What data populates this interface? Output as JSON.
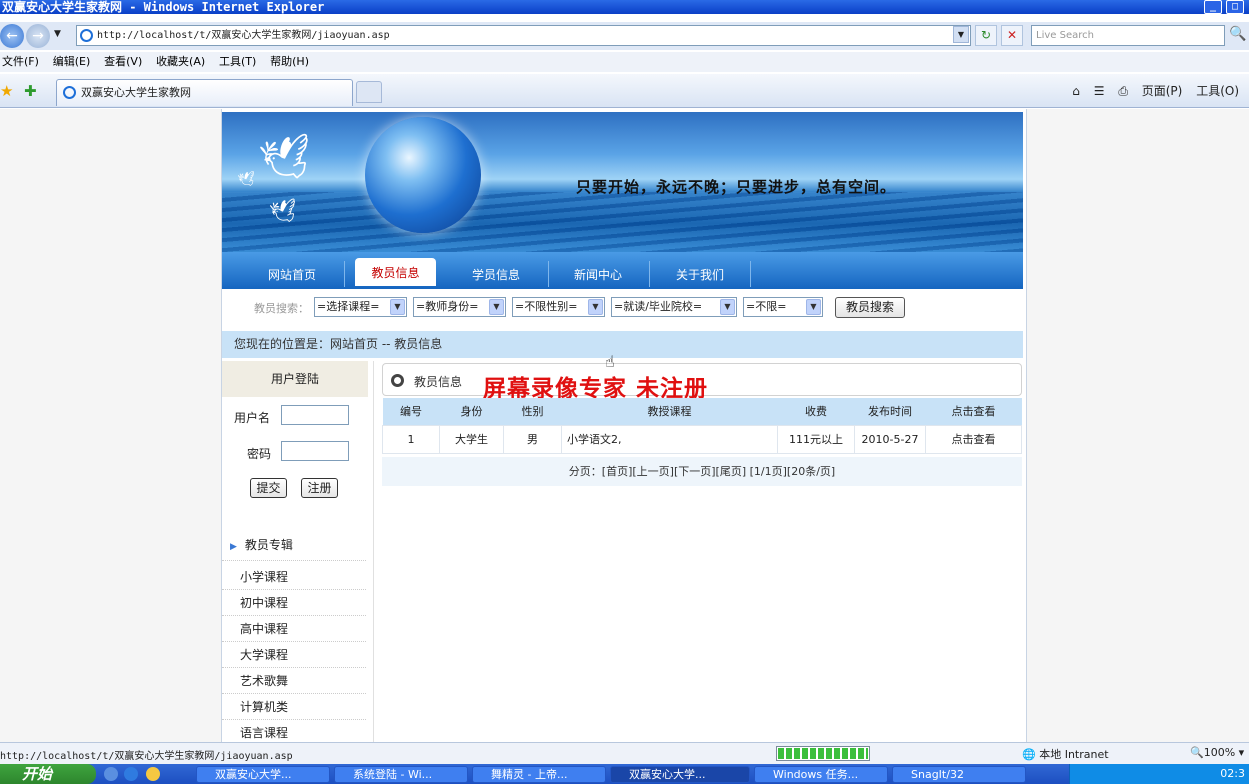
{
  "window": {
    "title": "双赢安心大学生家教网 - Windows Internet Explorer",
    "min": "_",
    "max": "□"
  },
  "toolbar": {
    "back": "←",
    "forward": "→",
    "address": "http://localhost/t/双赢安心大学生家教网/jiaoyuan.asp",
    "refresh": "↻",
    "stop": "✕",
    "search_placeholder": "Live Search",
    "search_go": "🔍"
  },
  "menu": {
    "items": [
      "文件(F)",
      "编辑(E)",
      "查看(V)",
      "收藏夹(A)",
      "工具(T)",
      "帮助(H)"
    ]
  },
  "tabs": {
    "active_label": "双赢安心大学生家教网"
  },
  "commands": {
    "home": "⌂",
    "feeds": "☰",
    "print": "⎙",
    "page": "页面(P)",
    "tools": "工具(O)"
  },
  "site": {
    "slogan": "只要开始，永远不晚；只要进步，总有空间。",
    "nav": [
      "网站首页",
      "教员信息",
      "学员信息",
      "新闻中心",
      "关于我们"
    ],
    "active_nav": "教员信息",
    "search": {
      "label": "教员搜索：",
      "selects": [
        "=选择课程=",
        "=教师身份=",
        "=不限性别=",
        "=就读/毕业院校=",
        "=不限="
      ],
      "button": "教员搜索"
    },
    "breadcrumb": "您现在的位置是：网站首页 -- 教员信息",
    "login": {
      "title": "用户登陆",
      "username_label": "用户名",
      "password_label": "密码",
      "submit": "提交",
      "register": "注册"
    },
    "categories_title": "教员专辑",
    "categories": [
      "小学课程",
      "初中课程",
      "高中课程",
      "大学课程",
      "艺术歌舞",
      "计算机类",
      "语言课程"
    ],
    "content": {
      "title": "教员信息",
      "watermark": "屏幕录像专家  未注册",
      "columns": [
        "编号",
        "身份",
        "性别",
        "教授课程",
        "收费",
        "发布时间",
        "点击查看"
      ],
      "rows": [
        [
          "1",
          "大学生",
          "男",
          "小学语文2,",
          "111元以上",
          "2010-5-27",
          "点击查看"
        ]
      ],
      "pager": "分页：[首页][上一页][下一页][尾页] [1/1页][20条/页]"
    }
  },
  "status": {
    "url": "http://localhost/t/双赢安心大学生家教网/jiaoyuan.asp",
    "zone": "本地 Intranet",
    "zoom": "100%",
    "progress": 1.0
  },
  "taskbar": {
    "start": "开始",
    "tasks": [
      "双赢安心大学...",
      "系统登陆 - Wi...",
      "舞精灵 - 上帝...",
      "双赢安心大学...",
      "Windows 任务...",
      "SnagIt/32"
    ],
    "active_task": 3,
    "clock": "02:3"
  }
}
